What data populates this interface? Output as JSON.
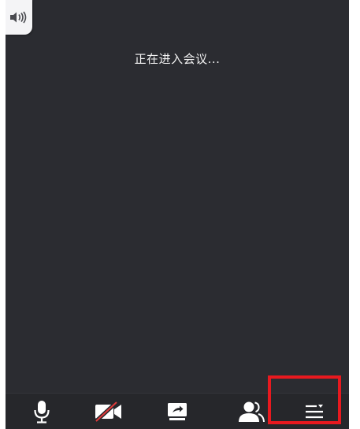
{
  "meeting": {
    "status_text": "正在进入会议..."
  },
  "speaker": {
    "icon": "speaker-icon"
  },
  "toolbar": {
    "buttons": [
      {
        "icon": "microphone-icon",
        "state": "on"
      },
      {
        "icon": "camera-off-icon",
        "state": "off"
      },
      {
        "icon": "share-screen-icon"
      },
      {
        "icon": "participants-icon"
      },
      {
        "icon": "more-menu-icon"
      }
    ]
  },
  "highlight": {
    "color": "#e8191f",
    "target": "more-menu-button"
  },
  "colors": {
    "background": "#2b2c31",
    "toolbar": "#26272b",
    "text": "#f2f2f2",
    "disabled_slash": "#e23a3a"
  }
}
